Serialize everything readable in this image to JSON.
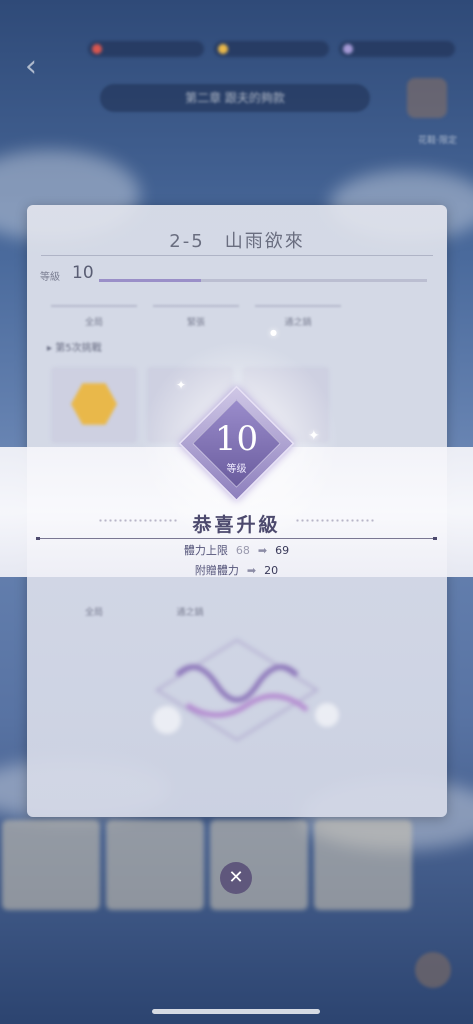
{
  "hud": {
    "chapter": "第二章 跟夫的夠款",
    "shoe_label": "花鞋·限定"
  },
  "stage_panel": {
    "title": "2-5　山雨欲來",
    "level_label": "等級",
    "level_value": "10",
    "level_progress": 0.31,
    "exp_text": "",
    "columns": [
      "全局",
      "緊張",
      "通之鍋"
    ],
    "section_label": "第5次挑戰",
    "section_right": "",
    "lower_columns": [
      "全局",
      "通之鍋"
    ]
  },
  "level_up": {
    "level_number": "10",
    "level_word": "等级",
    "title": "恭喜升級",
    "stats": [
      {
        "name": "體力上限",
        "old": "68",
        "arrow": "➡",
        "new": "69"
      },
      {
        "name": "附贈體力",
        "old": "",
        "arrow": "➡",
        "new": "20"
      }
    ]
  },
  "close_label": "✕",
  "colors": {
    "accent": "#8d7fbd",
    "title": "#4d4a6e"
  }
}
